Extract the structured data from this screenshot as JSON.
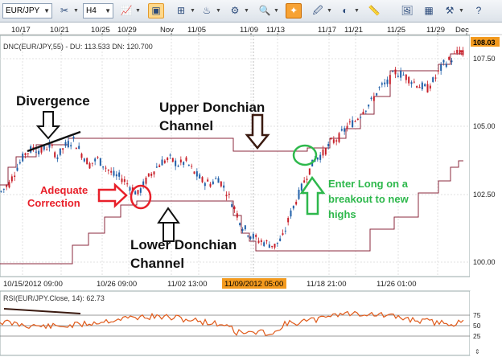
{
  "toolbar": {
    "symbol": "EUR/JPY",
    "timeframe": "H4",
    "icons": [
      "chart-type-icon",
      "line-tool-icon",
      "hand-icon",
      "zoom-in-icon",
      "zoom-out-icon",
      "zoom-window-icon",
      "crosshair-icon",
      "annotation-icon",
      "globe-icon",
      "ruler-icon",
      "image-icon",
      "grid-icon",
      "settings-icon"
    ]
  },
  "top_axis": {
    "labels": [
      "10/17",
      "10/21",
      "10/25",
      "10/29",
      "Nov",
      "11/05",
      "11/09",
      "11/13",
      "11/17",
      "11/21",
      "11/25",
      "11/29",
      "Dec"
    ]
  },
  "main_chart": {
    "indicator_legend": "DNC(EUR/JPY,55) - DU: 113.533  DN: 120.700",
    "price_labels": [
      "107.50",
      "105.00",
      "102.50",
      "100.00"
    ],
    "current_price": "108.03",
    "date_labels": [
      "10/15/2012 09:00",
      "10/26 09:00",
      "11/02 13:00",
      "11/18 21:00",
      "11/26 01:00"
    ],
    "highlighted_date": "11/09/2012 05:00",
    "annotations": {
      "divergence": "Divergence",
      "upper_line1": "Upper Donchian",
      "upper_line2": "Channel",
      "adequate_line1": "Adequate",
      "adequate_line2": "Correction",
      "lower_line1": "Lower Donchian",
      "lower_line2": "Channel",
      "enter_line1": "Enter Long on a",
      "enter_line2": "breakout to new",
      "enter_line3": "highs"
    },
    "colors": {
      "channel": "#8b2a3e",
      "candle_up": "#1f5fa8",
      "candle_down": "#c8202a",
      "annotation_red": "#e8202a",
      "annotation_green": "#2eb84c",
      "highlight": "#f39a1e"
    }
  },
  "rsi_panel": {
    "legend": "RSI(EUR/JPY.Close, 14): 62.73",
    "levels": [
      "75",
      "50",
      "25"
    ],
    "line_color": "#e05a1a"
  }
}
